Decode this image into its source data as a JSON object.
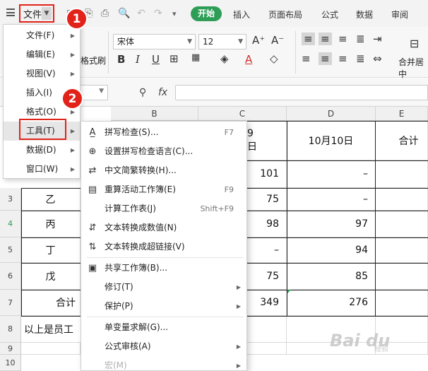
{
  "top": {
    "file_label": "文件",
    "start_tab": "开始",
    "tabs": [
      "插入",
      "页面布局",
      "公式",
      "数据",
      "审阅"
    ]
  },
  "ribbon": {
    "font_name": "宋体",
    "font_size": "12",
    "format_painter": "格式刷",
    "merge_center": "合并居中"
  },
  "columns": [
    "B",
    "C",
    "D",
    "E"
  ],
  "rows": [
    "3",
    "4",
    "5",
    "6",
    "7",
    "8",
    "9",
    "10"
  ],
  "table": {
    "header_c": "9日",
    "header_d": "10月10日",
    "header_e": "合计",
    "row2": {
      "c": "101",
      "d": "–"
    },
    "row3": {
      "b": "乙",
      "c": "75",
      "d": "–"
    },
    "row4": {
      "b": "丙",
      "c": "98",
      "d": "97"
    },
    "row5": {
      "b": "丁",
      "c": "–",
      "d": "94"
    },
    "row6": {
      "b": "戊",
      "c": "75",
      "d": "85"
    },
    "row7": {
      "b": "合计",
      "c": "349",
      "d": "276"
    },
    "row8": {
      "b": "以上是员工"
    }
  },
  "menu1": [
    {
      "label": "文件(F)"
    },
    {
      "label": "编辑(E)"
    },
    {
      "label": "视图(V)"
    },
    {
      "label": "插入(I)"
    },
    {
      "label": "格式(O)"
    },
    {
      "label": "工具(T)"
    },
    {
      "label": "数据(D)"
    },
    {
      "label": "窗口(W)"
    }
  ],
  "menu2": [
    {
      "label": "拼写检查(S)...",
      "shortcut": "F7",
      "icon": "spellcheck-icon"
    },
    {
      "label": "设置拼写检查语言(C)...",
      "icon": "language-icon"
    },
    {
      "label": "中文简繁转换(H)...",
      "icon": "convert-icon"
    },
    {
      "label": "重算活动工作簿(E)",
      "shortcut": "F9",
      "icon": "recalc-icon"
    },
    {
      "label": "计算工作表(J)",
      "shortcut": "Shift+F9"
    },
    {
      "label": "文本转换成数值(N)",
      "icon": "text-to-number-icon"
    },
    {
      "label": "文本转换成超链接(V)",
      "icon": "hyperlink-icon"
    },
    {
      "label": "共享工作簿(B)...",
      "icon": "share-icon"
    },
    {
      "label": "修订(T)"
    },
    {
      "label": "保护(P)"
    },
    {
      "label": "单变量求解(G)..."
    },
    {
      "label": "公式审核(A)"
    },
    {
      "label": "宏(M)"
    }
  ],
  "badges": [
    "1",
    "2"
  ],
  "watermark": {
    "main": "Bai du",
    "sub": "经验"
  }
}
